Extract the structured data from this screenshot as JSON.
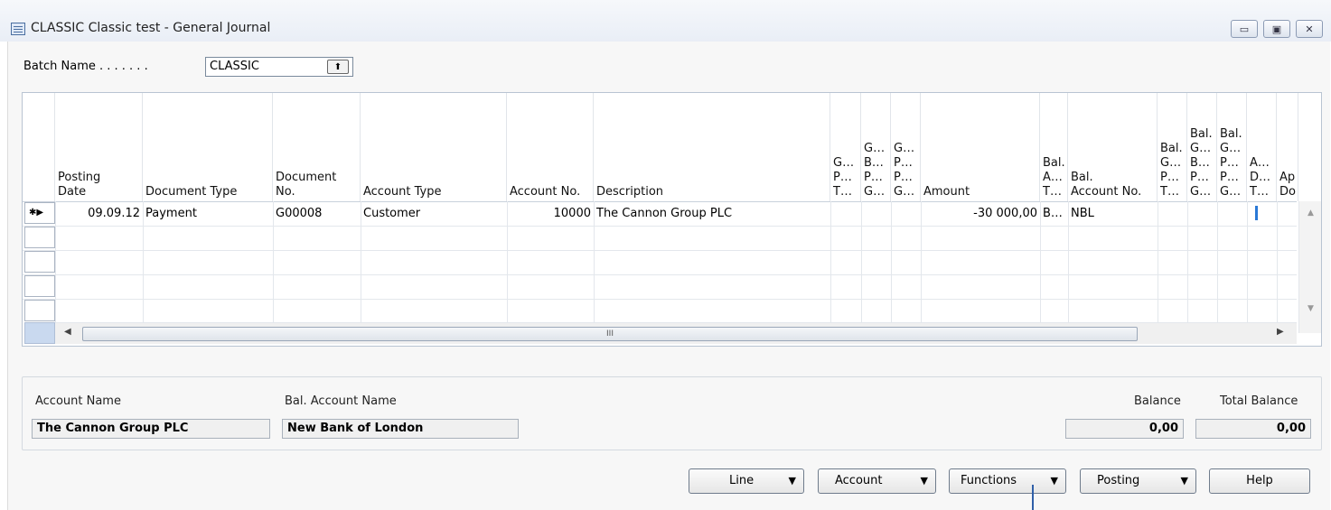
{
  "window": {
    "title": "CLASSIC Classic test - General Journal",
    "controls": {
      "minimize": "▭",
      "restore": "▣",
      "close": "✕"
    }
  },
  "batch": {
    "label": "Batch Name . . . . . . .",
    "value": "CLASSIC",
    "lookup_glyph": "⬆"
  },
  "grid": {
    "headers": {
      "posting_date": "Posting\nDate",
      "document_type": "Document Type",
      "document_no": "Document\nNo.",
      "account_type": "Account Type",
      "account_no": "Account No.",
      "description": "Description",
      "gpt": "G…\nP…\nT…",
      "gbpg": "G…\nB…\nP…\nG…",
      "gppg": "G…\nP…\nP…\nG…",
      "amount": "Amount",
      "bal_at": "Bal.\nA…\nT…",
      "bal_account_no": "Bal.\nAccount No.",
      "bal_gpt": "Bal.\nG…\nP…\nT…",
      "bal_gbpg": "Bal.\nG…\nB…\nP…\nG…",
      "bal_gppg": "Bal.\nG…\nP…\nP…\nG…",
      "adt": "A…\nD…\nT…",
      "apdo": "Ap\nDo"
    },
    "rows": [
      {
        "selector": "✱▶",
        "posting_date": "09.09.12",
        "document_type": "Payment",
        "document_no": "G00008",
        "account_type": "Customer",
        "account_no": "10000",
        "description": "The Cannon Group PLC",
        "amount": "-30 000,00",
        "bal_at": "B…",
        "bal_account_no": "NBL"
      }
    ],
    "scroll_thumb_grip": "III"
  },
  "panel": {
    "account_name_label": "Account Name",
    "account_name": "The Cannon Group PLC",
    "bal_account_name_label": "Bal. Account Name",
    "bal_account_name": "New Bank of London",
    "balance_label": "Balance",
    "balance": "0,00",
    "total_balance_label": "Total Balance",
    "total_balance": "0,00"
  },
  "buttons": {
    "line": "Line",
    "account": "Account",
    "functions": "Functions",
    "posting": "Posting",
    "help": "Help",
    "dropdown_glyph": "▼"
  }
}
